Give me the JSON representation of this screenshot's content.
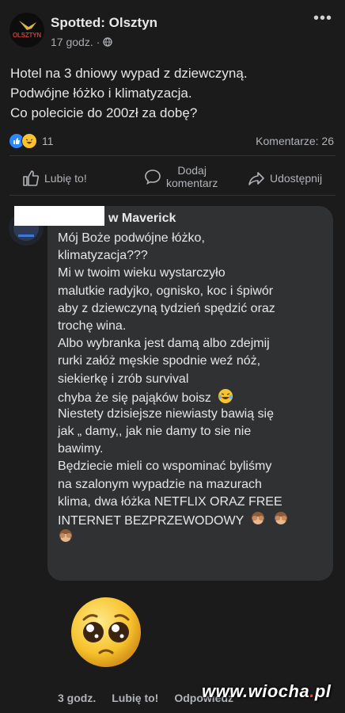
{
  "post": {
    "page_name": "Spotted: Olsztyn",
    "logo_text": "OLSZTYN",
    "time": "17 godz.",
    "separator": "·",
    "lines": [
      "Hotel na 3 dniowy wypad z dziewczyną.",
      "Podwójne łóżko i klimatyzacja.",
      "Co polecicie do 200zł za dobę?"
    ],
    "reaction_count": "11",
    "comments_count": "Komentarze: 26"
  },
  "actions": {
    "like": "Lubię to!",
    "comment_line1": "Dodaj",
    "comment_line2": "komentarz",
    "share": "Udostępnij"
  },
  "comment": {
    "author_visible": "w Maverick",
    "lines": [
      "Mój Boże podwójne łóżko,",
      "klimatyzacja???",
      "Mi w twoim wieku wystarczyło",
      "malutkie radyjko, ognisko, koc i śpiwór",
      "aby z dziewczyną tydzień spędzić oraz",
      "trochę wina.",
      "Albo wybranka jest damą albo zdejmij",
      "rurki załóż męskie spodnie weź nóż,",
      "siekierkę i zrób survival",
      "chyba że się pająków boisz",
      "Niestety dzisiejsze niewiasty bawią się",
      "jak „ damy,, jak nie damy to sie nie",
      "bawimy.",
      "Będziecie mieli co wspominać byliśmy",
      "na szalonym wypadzie na mazurach",
      "klima, dwa łóżka NETFLIX ORAZ FREE",
      "INTERNET BEZPRZEWODOWY",
      ""
    ],
    "time": "3 godz.",
    "like": "Lubię to!",
    "reply": "Odpowiedz"
  },
  "watermark": {
    "prefix": "www.",
    "name": "wiocha",
    "dot": ".",
    "suffix": "pl"
  }
}
